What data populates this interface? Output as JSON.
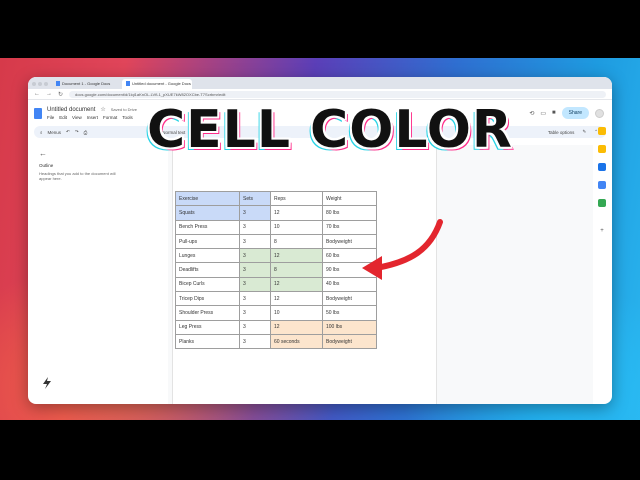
{
  "overlay": {
    "headline": "CELL COLOR",
    "brand_name": "AsapGuide"
  },
  "browser": {
    "tabs": [
      "Document 1 - Google Docs",
      "Untitled document - Google Docs"
    ],
    "url": "docs.google.com/document/d/1lqi1aKnOL-LVfL1_pXUE7kW82OXCbe-T7Scrbmr/edit"
  },
  "docs": {
    "title": "Untitled document",
    "saved_status": "Saved to Drive",
    "menus": [
      "File",
      "Edit",
      "View",
      "Insert",
      "Format",
      "Tools"
    ],
    "share_label": "Share",
    "toolbar": {
      "menus_label": "Menus",
      "style_label": "Normal text",
      "font_size": "11",
      "table_options": "Table options"
    },
    "outline": {
      "label": "Outline",
      "hint": "Headings that you add to the document will appear here."
    }
  },
  "table": {
    "headers": [
      "Exercise",
      "Sets",
      "Reps",
      "Weight"
    ],
    "rows": [
      [
        "Squats",
        "3",
        "12",
        "80 lbs"
      ],
      [
        "Bench Press",
        "3",
        "10",
        "70 lbs"
      ],
      [
        "Pull-ups",
        "3",
        "8",
        "Bodyweight"
      ],
      [
        "Lunges",
        "3",
        "12",
        "60 lbs"
      ],
      [
        "Deadlifts",
        "3",
        "8",
        "90 lbs"
      ],
      [
        "Bicep Curls",
        "3",
        "12",
        "40 lbs"
      ],
      [
        "Tricep Dips",
        "3",
        "12",
        "Bodyweight"
      ],
      [
        "Shoulder Press",
        "3",
        "10",
        "50 lbs"
      ],
      [
        "Leg Press",
        "3",
        "12",
        "100 lbs"
      ],
      [
        "Planks",
        "3",
        "60 seconds",
        "Bodyweight"
      ]
    ]
  },
  "colors": {
    "cell_blue": "#c9daf8",
    "cell_green": "#d9ead3",
    "cell_orange": "#fce5cd",
    "arrow_red": "#e3262e",
    "share_button": "#c2e7ff"
  }
}
